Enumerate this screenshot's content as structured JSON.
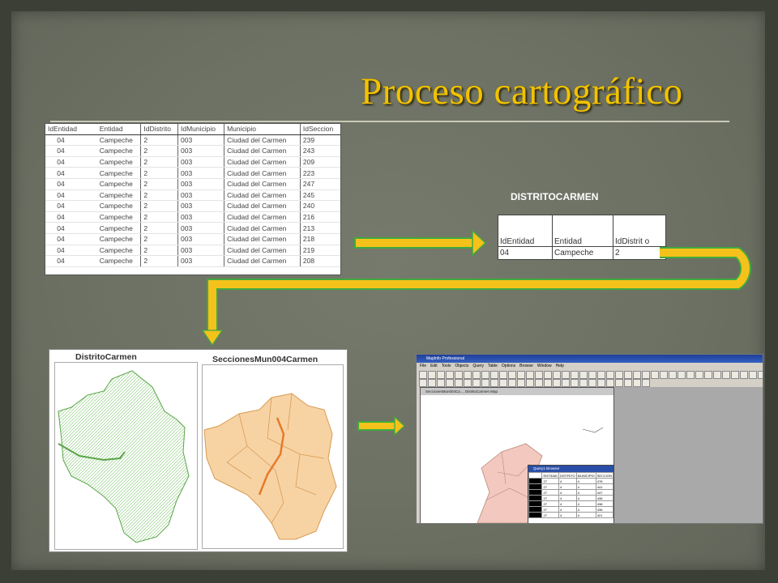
{
  "slide": {
    "title": "Proceso cartográfico",
    "colors": {
      "background": "#6d7163",
      "title": "#f2c200",
      "arrow": "#f4c21b",
      "arrow_outline": "#3faa3f"
    }
  },
  "source_table": {
    "columns": [
      "IdEntidad",
      "Entidad",
      "IdDistrito",
      "IdMunicipio",
      "Municipio",
      "IdSeccion"
    ],
    "rows": [
      [
        "04",
        "Campeche",
        "2",
        "003",
        "Ciudad del Carmen",
        "239"
      ],
      [
        "04",
        "Campeche",
        "2",
        "003",
        "Ciudad del Carmen",
        "243"
      ],
      [
        "04",
        "Campeche",
        "2",
        "003",
        "Ciudad del Carmen",
        "209"
      ],
      [
        "04",
        "Campeche",
        "2",
        "003",
        "Ciudad del Carmen",
        "223"
      ],
      [
        "04",
        "Campeche",
        "2",
        "003",
        "Ciudad del Carmen",
        "247"
      ],
      [
        "04",
        "Campeche",
        "2",
        "003",
        "Ciudad del Carmen",
        "245"
      ],
      [
        "04",
        "Campeche",
        "2",
        "003",
        "Ciudad del Carmen",
        "240"
      ],
      [
        "04",
        "Campeche",
        "2",
        "003",
        "Ciudad del Carmen",
        "216"
      ],
      [
        "04",
        "Campeche",
        "2",
        "003",
        "Ciudad del Carmen",
        "213"
      ],
      [
        "04",
        "Campeche",
        "2",
        "003",
        "Ciudad del Carmen",
        "218"
      ],
      [
        "04",
        "Campeche",
        "2",
        "003",
        "Ciudad del Carmen",
        "219"
      ],
      [
        "04",
        "Campeche",
        "2",
        "003",
        "Ciudad del Carmen",
        "208"
      ]
    ]
  },
  "distrito_table": {
    "title": "DISTRITOCARMEN",
    "columns": [
      "IdEntidad",
      "Entidad",
      "IdDistrit o"
    ],
    "rows": [
      [
        "04",
        "Campeche",
        "2"
      ]
    ]
  },
  "maps": {
    "left_title": "DistritoCarmen",
    "right_title": "SeccionesMun004Carmen",
    "colors": {
      "district": "#7bc46a",
      "sections": "#f3c48a"
    }
  },
  "mapinfo": {
    "app_title": "MapInfo Professional",
    "menu": [
      "File",
      "Edit",
      "Tools",
      "Objects",
      "Query",
      "Table",
      "Options",
      "Browse",
      "Window",
      "Help"
    ],
    "map_window_title": "SeccionesMun004Ca..., DistritoCarmen Map",
    "browser_title": "Query1 Browser",
    "browser_columns": [
      "ENTIDAD",
      "DISTRITO",
      "MUNICIPIO",
      "SECCION"
    ],
    "browser_rows": [
      [
        "27",
        "4",
        "4",
        "476"
      ],
      [
        "27",
        "4",
        "4",
        "441"
      ],
      [
        "27",
        "4",
        "4",
        "447"
      ],
      [
        "27",
        "4",
        "4",
        "436"
      ],
      [
        "27",
        "4",
        "4",
        "438"
      ],
      [
        "27",
        "4",
        "4",
        "436"
      ],
      [
        "27",
        "4",
        "4",
        "421"
      ]
    ]
  }
}
